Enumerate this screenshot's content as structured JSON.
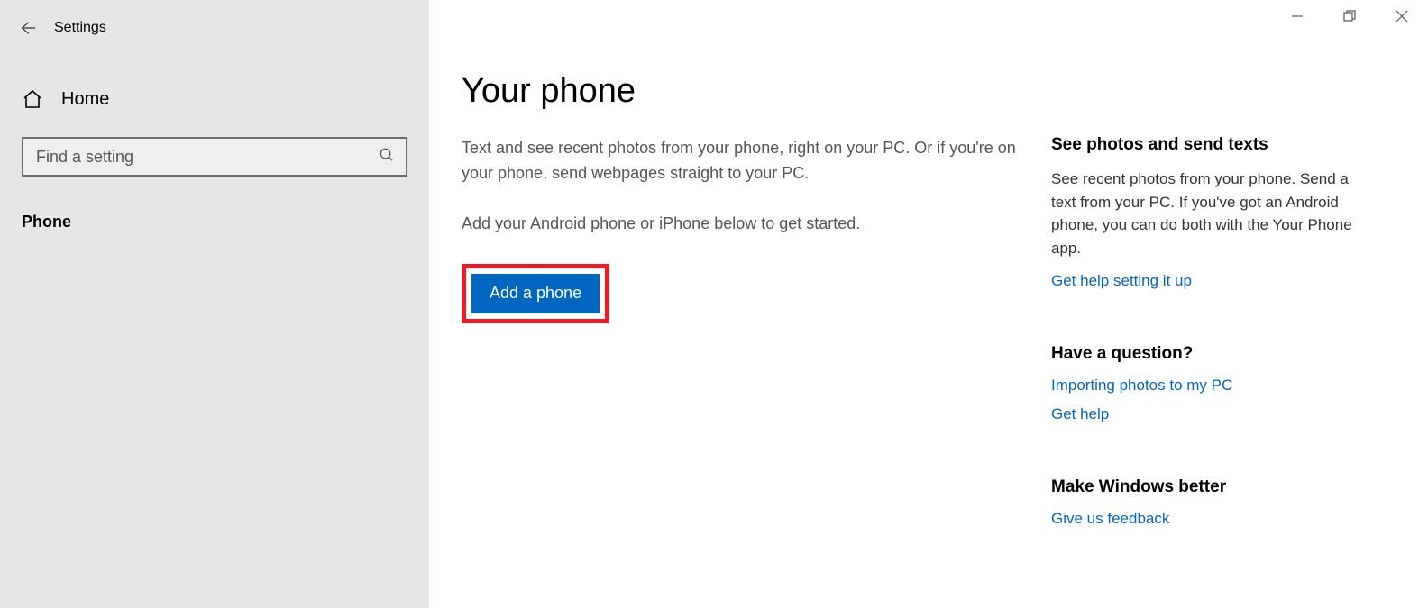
{
  "header": {
    "title": "Settings"
  },
  "sidebar": {
    "home_label": "Home",
    "search_placeholder": "Find a setting",
    "category": "Phone"
  },
  "main": {
    "title": "Your phone",
    "desc1": "Text and see recent photos from your phone, right on your PC. Or if you're on your phone, send webpages straight to your PC.",
    "desc2": "Add your Android phone or iPhone below to get started.",
    "add_button": "Add a phone"
  },
  "aside": {
    "photos_heading": "See photos and send texts",
    "photos_desc": "See recent photos from your phone. Send a text from your PC. If you've got an Android phone, you can do both with the Your Phone app.",
    "setup_link": "Get help setting it up",
    "question_heading": "Have a question?",
    "import_link": "Importing photos to my PC",
    "help_link": "Get help",
    "better_heading": "Make Windows better",
    "feedback_link": "Give us feedback"
  }
}
